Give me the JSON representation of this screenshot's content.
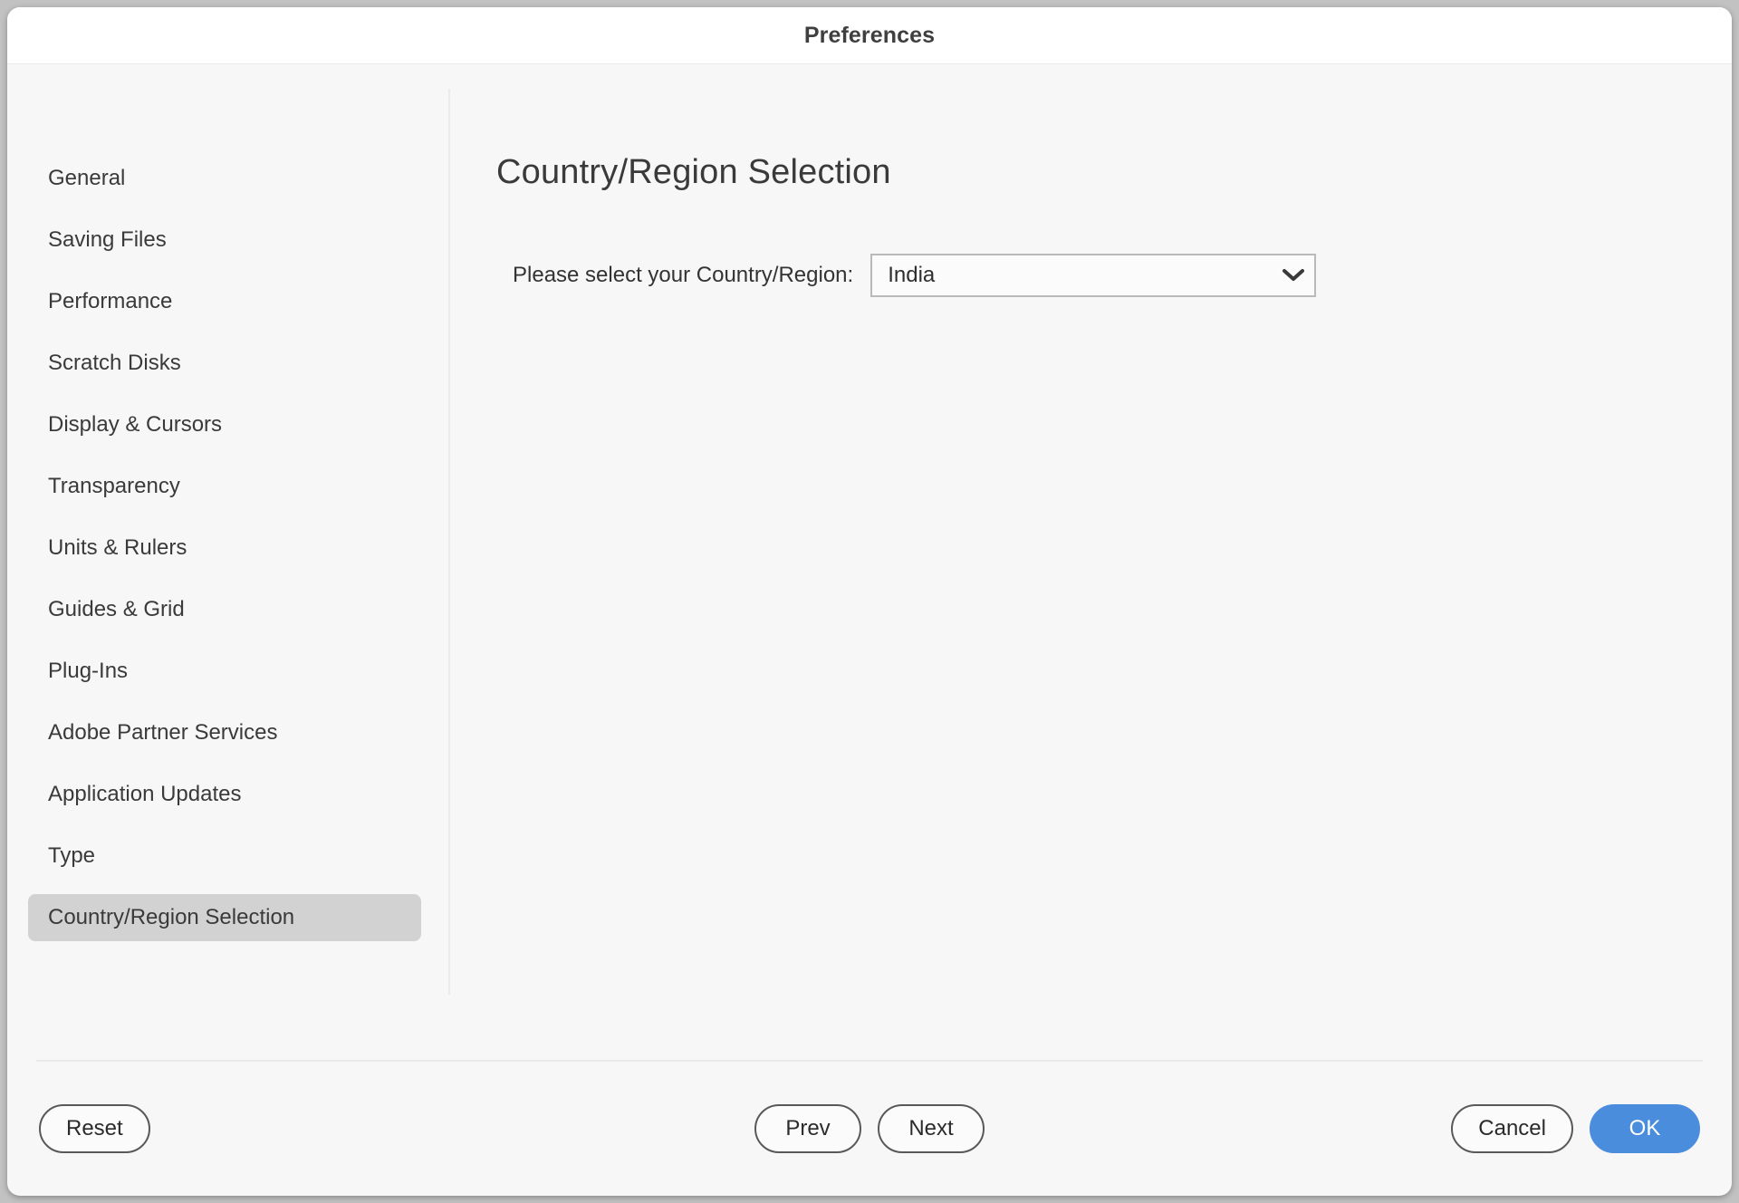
{
  "window": {
    "title": "Preferences"
  },
  "sidebar": {
    "items": [
      {
        "label": "General",
        "selected": false
      },
      {
        "label": "Saving Files",
        "selected": false
      },
      {
        "label": "Performance",
        "selected": false
      },
      {
        "label": "Scratch Disks",
        "selected": false
      },
      {
        "label": "Display & Cursors",
        "selected": false
      },
      {
        "label": "Transparency",
        "selected": false
      },
      {
        "label": "Units & Rulers",
        "selected": false
      },
      {
        "label": "Guides & Grid",
        "selected": false
      },
      {
        "label": "Plug-Ins",
        "selected": false
      },
      {
        "label": "Adobe Partner Services",
        "selected": false
      },
      {
        "label": "Application Updates",
        "selected": false
      },
      {
        "label": "Type",
        "selected": false
      },
      {
        "label": "Country/Region Selection",
        "selected": true
      }
    ]
  },
  "content": {
    "panel_title": "Country/Region Selection",
    "country_field": {
      "label": "Please select your Country/Region:",
      "value": "India",
      "chevron_icon": "chevron-down-icon"
    }
  },
  "footer": {
    "reset_label": "Reset",
    "prev_label": "Prev",
    "next_label": "Next",
    "cancel_label": "Cancel",
    "ok_label": "OK"
  },
  "colors": {
    "primary": "#4a8ddd",
    "selected_item_bg": "#d2d2d2",
    "window_bg": "#f7f7f7",
    "titlebar_bg": "#ffffff",
    "desktop_bg": "#c2c2c2"
  }
}
